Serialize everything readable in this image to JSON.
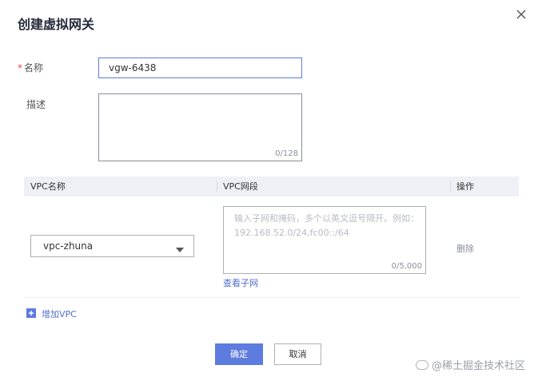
{
  "dialog": {
    "title": "创建虚拟网关",
    "close_icon": "close-icon"
  },
  "form": {
    "name": {
      "required_mark": "*",
      "label": "名称",
      "value": "vgw-6438"
    },
    "description": {
      "label": "描述",
      "value": "",
      "char_count": "0/128"
    }
  },
  "vpc_table": {
    "columns": [
      "VPC名称",
      "VPC网段",
      "操作"
    ],
    "rows": [
      {
        "vpc_name": "vpc-zhuna",
        "cidr_placeholder": "输入子网和掩码，多个以英文逗号隔开。例如：192.168.52.0/24,fc00::/64",
        "cidr_value": "",
        "cidr_char_count": "0/5,000",
        "view_subnet_link": "查看子网",
        "delete_label": "删除"
      }
    ],
    "add_vpc_label": "增加VPC",
    "add_icon": "plus-icon"
  },
  "footer": {
    "confirm_label": "确定",
    "cancel_label": "取消"
  },
  "watermark": {
    "text": "@稀土掘金技术社区"
  },
  "colors": {
    "primary": "#5e7ce0",
    "link": "#526ecc",
    "required": "#e64545",
    "table_header_bg": "#eef0f5"
  }
}
